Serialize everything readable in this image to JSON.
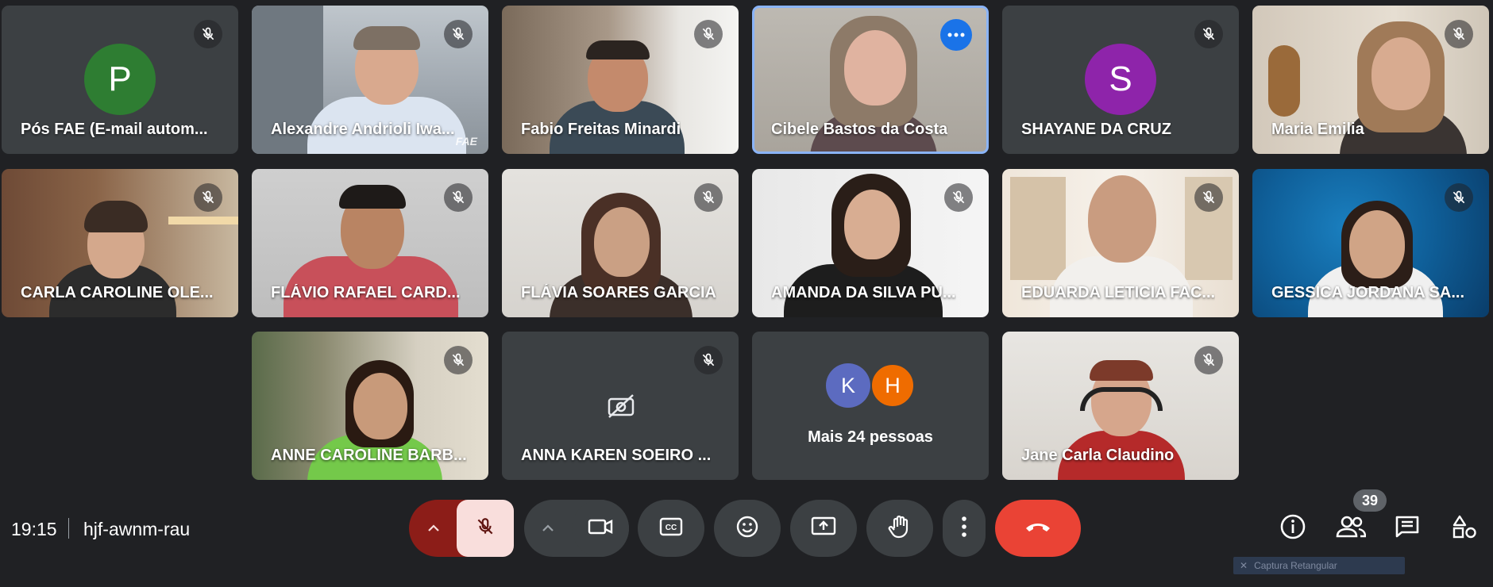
{
  "participants": [
    {
      "name": "Pós FAE (E-mail autom...",
      "avatar_letter": "P",
      "avatar_color": "#2e7d32"
    },
    {
      "name": "Alexandre Andrioli Iwa...",
      "watermark": "FAE"
    },
    {
      "name": "Fabio Freitas Minardi"
    },
    {
      "name": "Cibele Bastos da Costa",
      "active_speaker": true
    },
    {
      "name": "SHAYANE DA CRUZ",
      "avatar_letter": "S",
      "avatar_color": "#8e24aa"
    },
    {
      "name": "Maria Emilia"
    },
    {
      "name": "CARLA CAROLINE OLE..."
    },
    {
      "name": "FLÁVIO RAFAEL CARD..."
    },
    {
      "name": "FLÁVIA SOARES GARCIA"
    },
    {
      "name": "AMANDA DA SILVA PU..."
    },
    {
      "name": "EDUARDA LETICIA FAC..."
    },
    {
      "name": "GESSICA JORDANA SA..."
    },
    {
      "name": "ANNE CAROLINE BARB..."
    },
    {
      "name": "ANNA KAREN SOEIRO ..."
    },
    {
      "name": "Jane Carla Claudino"
    }
  ],
  "more_tile": {
    "label": "Mais 24 pessoas",
    "avatars": [
      {
        "letter": "K",
        "color": "#5c6bc0"
      },
      {
        "letter": "H",
        "color": "#ef6c00"
      }
    ]
  },
  "meeting": {
    "time": "19:15",
    "code": "hjf-awnm-rau",
    "participant_count": "39"
  },
  "tooltip": "Captura Retangular",
  "colors": {
    "background": "#202124",
    "tile": "#3c4043",
    "mic_off_active": "#f9dedc",
    "mic_off_group": "#8c1d18",
    "leave": "#ea4335",
    "active_border": "#8ab4f8"
  },
  "controls": {
    "icons": [
      "chevron-up-icon",
      "mic-off-icon",
      "camera-icon",
      "captions-icon",
      "emoji-icon",
      "present-icon",
      "raise-hand-icon",
      "more-vert-icon",
      "end-call-icon"
    ],
    "right_icons": [
      "info-icon",
      "people-icon",
      "chat-icon",
      "activities-icon"
    ]
  }
}
